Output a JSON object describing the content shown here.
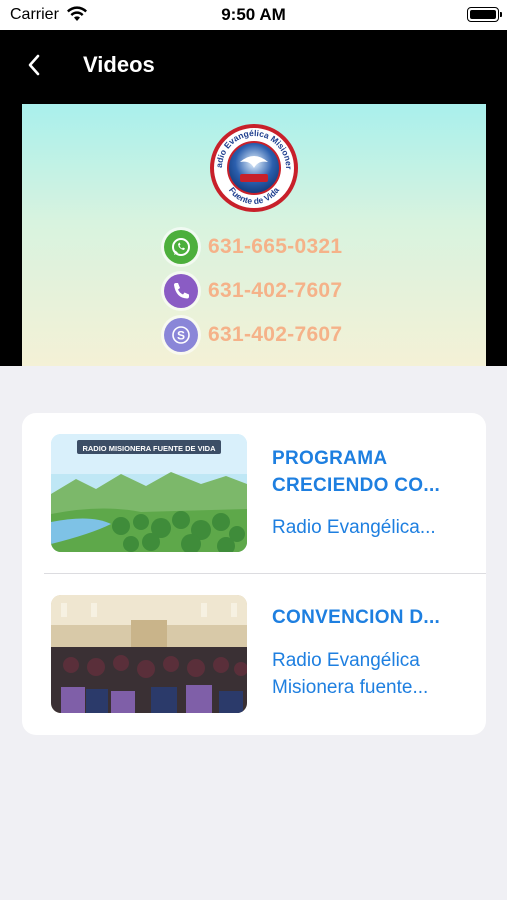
{
  "status_bar": {
    "carrier": "Carrier",
    "time": "9:50 AM"
  },
  "nav": {
    "title": "Videos"
  },
  "banner": {
    "logo_text_top": "Radio Evangélica Misionera",
    "logo_text_bottom": "Fuente de Vida",
    "contacts": [
      {
        "icon": "whatsapp-icon",
        "number": "631-665-0321",
        "color": "#4caf3c"
      },
      {
        "icon": "viber-icon",
        "number": "631-402-7607",
        "color": "#8a5cc4"
      },
      {
        "icon": "skype-icon",
        "number": "631-402-7607",
        "color": "#8a86d8"
      }
    ]
  },
  "videos": [
    {
      "thumb_caption": "RADIO MISIONERA FUENTE DE VIDA",
      "title_lines": [
        "PROGRAMA",
        "CRECIENDO CO..."
      ],
      "subtitle_lines": [
        "Radio Evangélica..."
      ]
    },
    {
      "thumb_caption": "",
      "title_lines": [
        "CONVENCION D..."
      ],
      "subtitle_lines": [
        "Radio Evangélica",
        "Misionera fuente..."
      ]
    }
  ],
  "colors": {
    "accent": "#1e7fe0",
    "phone_text": "#f5b289",
    "nav_bg": "#000000"
  }
}
